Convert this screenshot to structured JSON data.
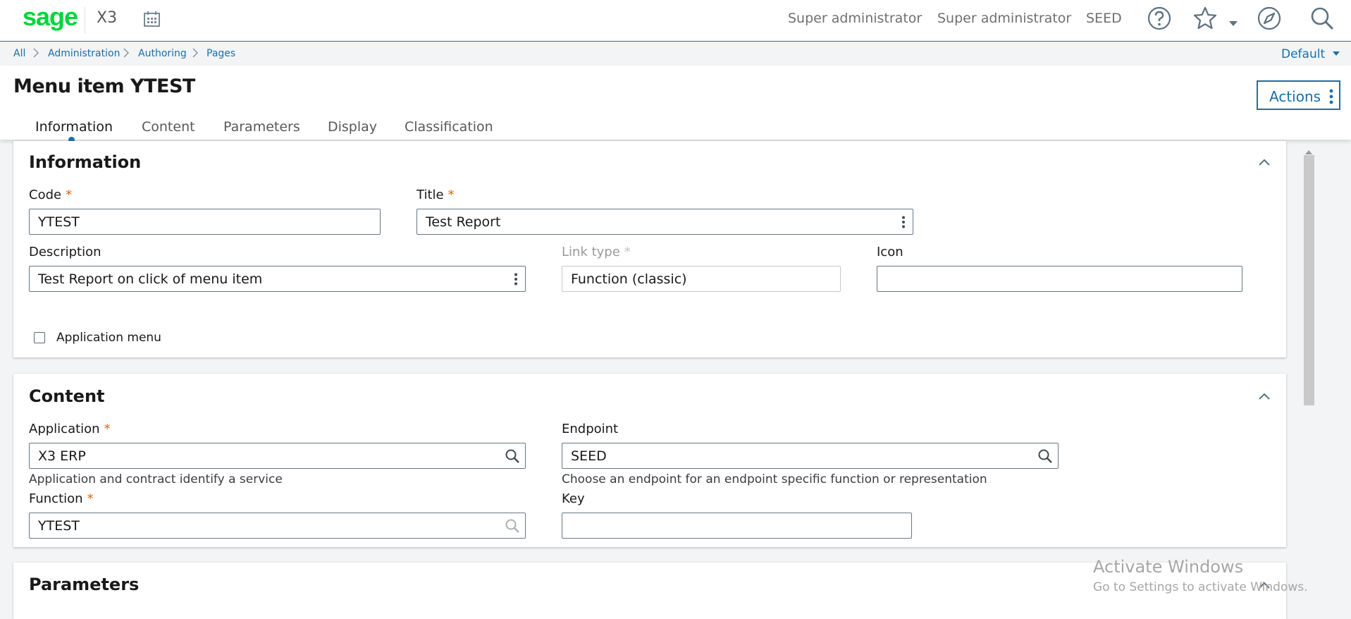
{
  "app": {
    "logo": "sage",
    "product": "X3",
    "user_role": "Super administrator",
    "user_name": "Super administrator",
    "folder": "SEED",
    "icons": [
      "calendar-icon",
      "help-icon",
      "star-icon",
      "chevron-down-icon",
      "compass-icon",
      "search-icon"
    ]
  },
  "breadcrumb": [
    "All",
    "Administration",
    "Authoring",
    "Pages"
  ],
  "view_selector": "Default",
  "page": {
    "title": "Menu item YTEST",
    "actions_label": "Actions"
  },
  "tabs": [
    {
      "label": "Information",
      "active": true
    },
    {
      "label": "Content",
      "active": false
    },
    {
      "label": "Parameters",
      "active": false
    },
    {
      "label": "Display",
      "active": false
    },
    {
      "label": "Classification",
      "active": false
    }
  ],
  "information": {
    "title": "Information",
    "code": {
      "label": "Code",
      "value": "YTEST",
      "required_mark": "*"
    },
    "title_field": {
      "label": "Title",
      "value": "Test Report",
      "required_mark": "*"
    },
    "description": {
      "label": "Description",
      "value": "Test Report on click of menu item"
    },
    "link_type": {
      "label": "Link type",
      "value": "Function (classic)",
      "required_mark": "*",
      "disabled": true
    },
    "icon": {
      "label": "Icon",
      "value": ""
    },
    "application_menu": {
      "label": "Application menu",
      "checked": false
    }
  },
  "content": {
    "title": "Content",
    "application": {
      "label": "Application",
      "value": "X3 ERP",
      "required_mark": "*",
      "help": "Application and contract identify a service"
    },
    "endpoint": {
      "label": "Endpoint",
      "value": "SEED",
      "help": "Choose an endpoint for an endpoint specific function or representation"
    },
    "function": {
      "label": "Function",
      "value": "YTEST",
      "required_mark": "*"
    },
    "key": {
      "label": "Key",
      "value": ""
    }
  },
  "parameters": {
    "title": "Parameters"
  },
  "watermark": {
    "line1": "Activate Windows",
    "line2": "Go to Settings to activate Windows."
  },
  "colors": {
    "brand_green": "#00d639",
    "accent_blue": "#1b6ea8",
    "required_orange": "#e96400",
    "background": "#f2f4f5"
  }
}
